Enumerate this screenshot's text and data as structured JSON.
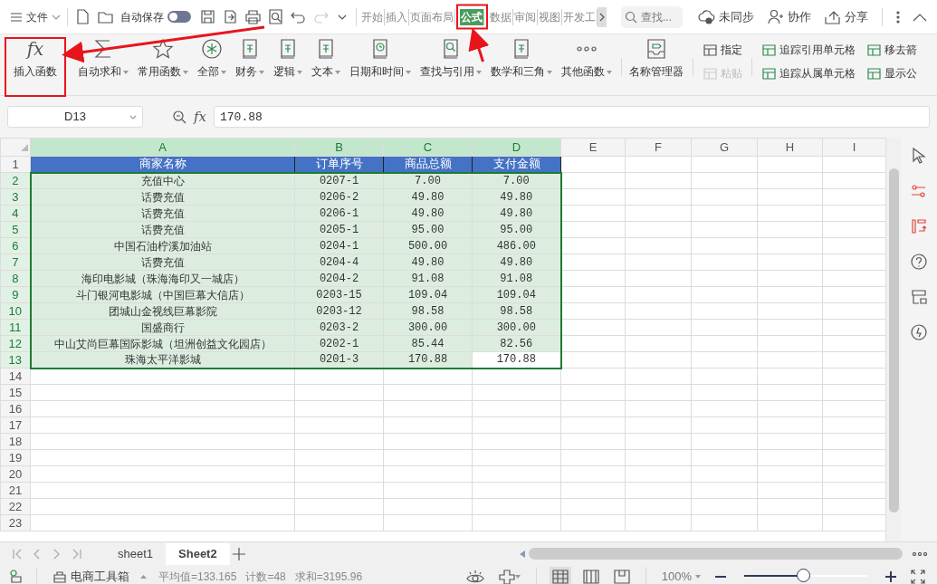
{
  "menu": {
    "label": "文件"
  },
  "quick_toolbar": {
    "autosave_label": "自动保存",
    "autosave_on": false
  },
  "tabs": [
    {
      "label": "开始",
      "selected": false
    },
    {
      "label": "插入",
      "selected": false
    },
    {
      "label": "页面布局",
      "selected": false
    },
    {
      "label": "公式",
      "selected": true
    },
    {
      "label": "数据",
      "selected": false
    },
    {
      "label": "审阅",
      "selected": false
    },
    {
      "label": "视图",
      "selected": false
    },
    {
      "label": "开发工",
      "selected": false
    }
  ],
  "search": {
    "placeholder": "查找..."
  },
  "header_actions": [
    {
      "kind": "sync",
      "label": "未同步"
    },
    {
      "kind": "collab",
      "label": "协作"
    },
    {
      "kind": "share",
      "label": "分享"
    }
  ],
  "ribbon": {
    "large": [
      {
        "kind": "fx",
        "icon_text": "fx",
        "label": "插入函数",
        "dropdown": false
      },
      {
        "kind": "sigma",
        "label": "自动求和",
        "dropdown": true
      },
      {
        "kind": "star",
        "label": "常用函数",
        "dropdown": true
      },
      {
        "kind": "all",
        "label": "全部",
        "dropdown": true
      },
      {
        "kind": "book",
        "label": "财务",
        "dropdown": true
      },
      {
        "kind": "book",
        "label": "逻辑",
        "dropdown": true
      },
      {
        "kind": "book",
        "label": "文本",
        "dropdown": true
      },
      {
        "kind": "clock",
        "label": "日期和时间",
        "dropdown": true
      },
      {
        "kind": "search",
        "label": "查找与引用",
        "dropdown": true
      },
      {
        "kind": "book",
        "label": "数学和三角",
        "dropdown": true
      },
      {
        "kind": "dots",
        "label": "其他函数",
        "dropdown": true
      },
      {
        "kind": "tray",
        "label": "名称管理器",
        "dropdown": false
      }
    ],
    "small": [
      {
        "label": "指定",
        "disabled": false
      },
      {
        "label": "粘贴",
        "disabled": true
      },
      {
        "label": "追踪引用单元格",
        "disabled": false
      },
      {
        "label": "追踪从属单元格",
        "disabled": false
      },
      {
        "label": "移去箭",
        "disabled": false
      },
      {
        "label": "显示公",
        "disabled": false
      }
    ]
  },
  "formula_bar": {
    "name_box": "D13",
    "fx_text": "fx",
    "value": "170.88"
  },
  "columns": [
    {
      "label": "A",
      "selected": true
    },
    {
      "label": "B",
      "selected": true
    },
    {
      "label": "C",
      "selected": true
    },
    {
      "label": "D",
      "selected": true
    },
    {
      "label": "E",
      "selected": false
    },
    {
      "label": "F",
      "selected": false
    },
    {
      "label": "G",
      "selected": false
    },
    {
      "label": "H",
      "selected": false
    },
    {
      "label": "I",
      "selected": false
    }
  ],
  "rows": [
    {
      "number": "1",
      "selected": false,
      "kind": "header",
      "cells": [
        "商家名称",
        "订单序号",
        "商品总额",
        "支付金额"
      ]
    },
    {
      "number": "2",
      "selected": true,
      "cells": [
        "充值中心",
        "0207-1",
        "7.00",
        "7.00"
      ]
    },
    {
      "number": "3",
      "selected": true,
      "cells": [
        "话费充值",
        "0206-2",
        "49.80",
        "49.80"
      ]
    },
    {
      "number": "4",
      "selected": true,
      "cells": [
        "话费充值",
        "0206-1",
        "49.80",
        "49.80"
      ]
    },
    {
      "number": "5",
      "selected": true,
      "cells": [
        "话费充值",
        "0205-1",
        "95.00",
        "95.00"
      ]
    },
    {
      "number": "6",
      "selected": true,
      "cells": [
        "中国石油柠溪加油站",
        "0204-1",
        "500.00",
        "486.00"
      ]
    },
    {
      "number": "7",
      "selected": true,
      "cells": [
        "话费充值",
        "0204-4",
        "49.80",
        "49.80"
      ]
    },
    {
      "number": "8",
      "selected": true,
      "cells": [
        "海印电影城（珠海海印又一城店）",
        "0204-2",
        "91.08",
        "91.08"
      ]
    },
    {
      "number": "9",
      "selected": true,
      "cells": [
        "斗门银河电影城（中国巨幕大信店）",
        "0203-15",
        "109.04",
        "109.04"
      ]
    },
    {
      "number": "10",
      "selected": true,
      "cells": [
        "团城山金视线巨幕影院",
        "0203-12",
        "98.58",
        "98.58"
      ]
    },
    {
      "number": "11",
      "selected": true,
      "cells": [
        "国盛商行",
        "0203-2",
        "300.00",
        "300.00"
      ]
    },
    {
      "number": "12",
      "selected": true,
      "cells": [
        "中山艾尚巨幕国际影城（坦洲创益文化园店）",
        "0202-1",
        "85.44",
        "82.56"
      ]
    },
    {
      "number": "13",
      "selected": true,
      "active": true,
      "cells": [
        "珠海太平洋影城",
        "0201-3",
        "170.88",
        "170.88"
      ]
    },
    {
      "number": "14",
      "selected": false,
      "cells": []
    },
    {
      "number": "15",
      "selected": false,
      "cells": []
    },
    {
      "number": "16",
      "selected": false,
      "cells": []
    },
    {
      "number": "17",
      "selected": false,
      "cells": []
    },
    {
      "number": "18",
      "selected": false,
      "cells": []
    },
    {
      "number": "19",
      "selected": false,
      "cells": []
    },
    {
      "number": "20",
      "selected": false,
      "cells": []
    },
    {
      "number": "21",
      "selected": false,
      "cells": []
    },
    {
      "number": "22",
      "selected": false,
      "cells": []
    },
    {
      "number": "23",
      "selected": false,
      "cells": []
    }
  ],
  "sheet_tabs": [
    {
      "label": "sheet1",
      "selected": false
    },
    {
      "label": "Sheet2",
      "selected": true
    }
  ],
  "status_bar": {
    "toolbox": "电商工具箱",
    "stats": [
      "平均值=133.165",
      "计数=48",
      "求和=3195.96"
    ],
    "views": [
      {
        "kind": "normal",
        "selected": true
      },
      {
        "kind": "columns",
        "selected": false
      },
      {
        "kind": "page",
        "selected": false
      }
    ],
    "zoom": "100%",
    "zoom_slider": {
      "level": 0.48
    }
  },
  "annotations": [
    {
      "kind": "frame"
    },
    {
      "kind": "frame"
    },
    {
      "kind": "arrow"
    },
    {
      "kind": "arrow"
    }
  ]
}
